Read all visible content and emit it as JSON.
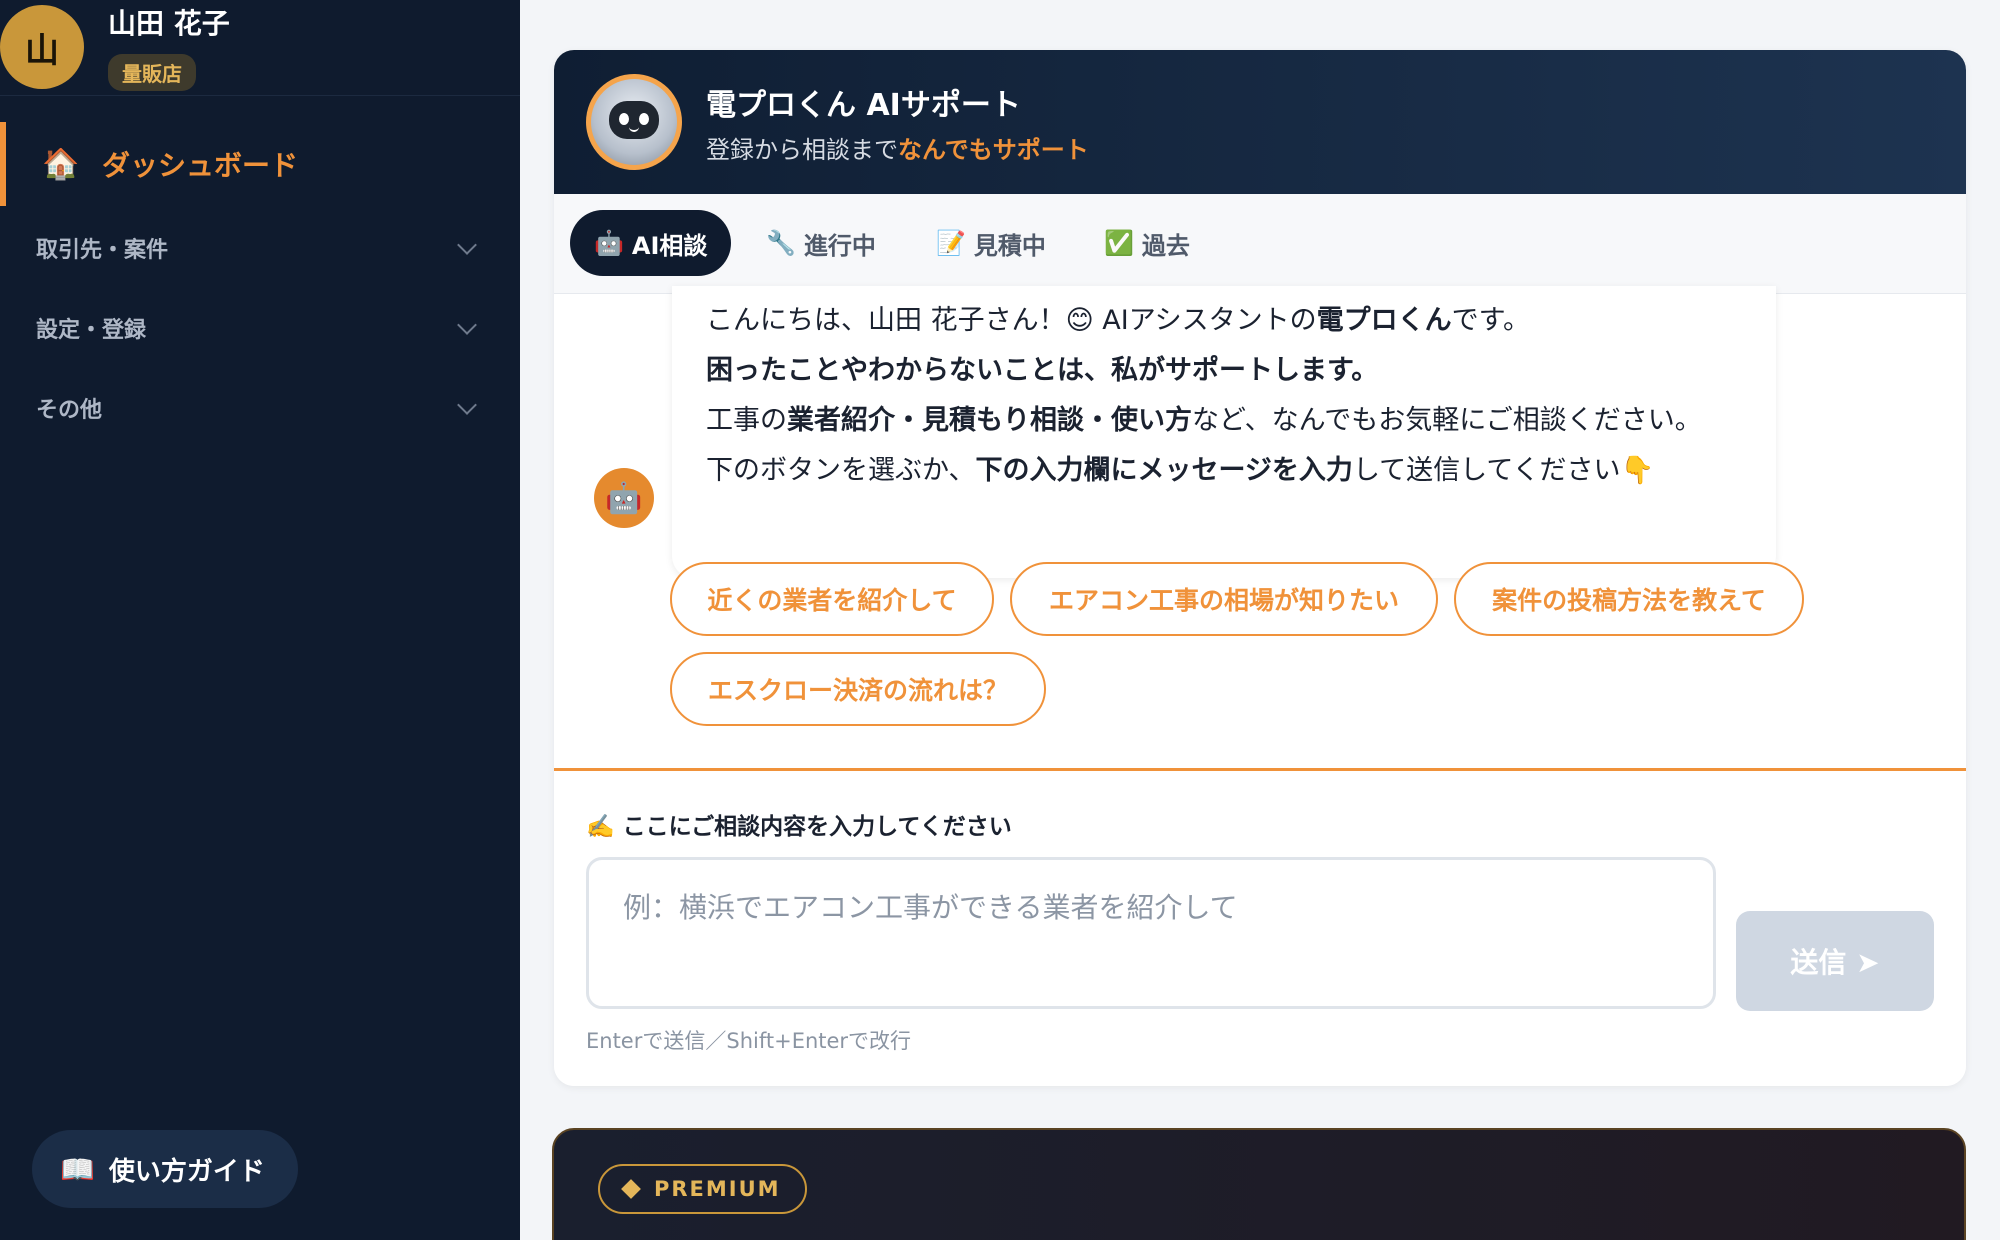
{
  "user": {
    "avatar_initial": "山",
    "name": "山田 花子",
    "role": "量販店"
  },
  "sidebar": {
    "active_item": {
      "icon": "house-icon",
      "icon_glyph": "🏠",
      "label": "ダッシュボード"
    },
    "groups": [
      {
        "label": "取引先・案件"
      },
      {
        "label": "設定・登録"
      },
      {
        "label": "その他"
      }
    ],
    "guide_button": {
      "icon": "book-icon",
      "icon_glyph": "📖",
      "label": "使い方ガイド"
    }
  },
  "chat": {
    "title": "電プロくん AIサポート",
    "subtitle_prefix": "登録から相談まで",
    "subtitle_highlight": "なんでもサポート",
    "tabs": [
      {
        "icon": "robot-icon",
        "icon_glyph": "🤖",
        "label": "AI相談",
        "active": true
      },
      {
        "icon": "wrench-icon",
        "icon_glyph": "🔧",
        "label": "進行中",
        "active": false
      },
      {
        "icon": "memo-icon",
        "icon_glyph": "📝",
        "label": "見積中",
        "active": false
      },
      {
        "icon": "check-icon",
        "icon_glyph": "✅",
        "label": "過去",
        "active": false
      }
    ],
    "message": {
      "avatar_glyph": "🤖",
      "line1": {
        "a": "こんにちは、山田 花子さん！😊 AIアシスタントの",
        "b": "電プロくん",
        "c": "です。"
      },
      "line2": "困ったことやわからないことは、私がサポートします。",
      "line3": {
        "a": "工事の",
        "b": "業者紹介・見積もり相談・使い方",
        "c": "など、なんでもお気軽にご相談ください。"
      },
      "line4": {
        "a": "下のボタンを選ぶか、",
        "b": "下の入力欄にメッセージを入力",
        "c": "して送信してください👇"
      }
    },
    "suggestions": [
      "近くの業者を紹介して",
      "エアコン工事の相場が知りたい",
      "案件の投稿方法を教えて",
      "エスクロー決済の流れは？"
    ],
    "input": {
      "label": "✍️ ここにご相談内容を入力してください",
      "value": "",
      "placeholder": "例：横浜でエアコン工事ができる業者を紹介して",
      "send_label": "送信 ➤",
      "hint": "Enterで送信／Shift+Enterで改行"
    }
  },
  "premium": {
    "badge": "PREMIUM"
  },
  "colors": {
    "sidebar_bg": "#0f1b2e",
    "accent": "#f0923a",
    "gold": "#e4b65a",
    "send_disabled": "#cfd7e2"
  }
}
